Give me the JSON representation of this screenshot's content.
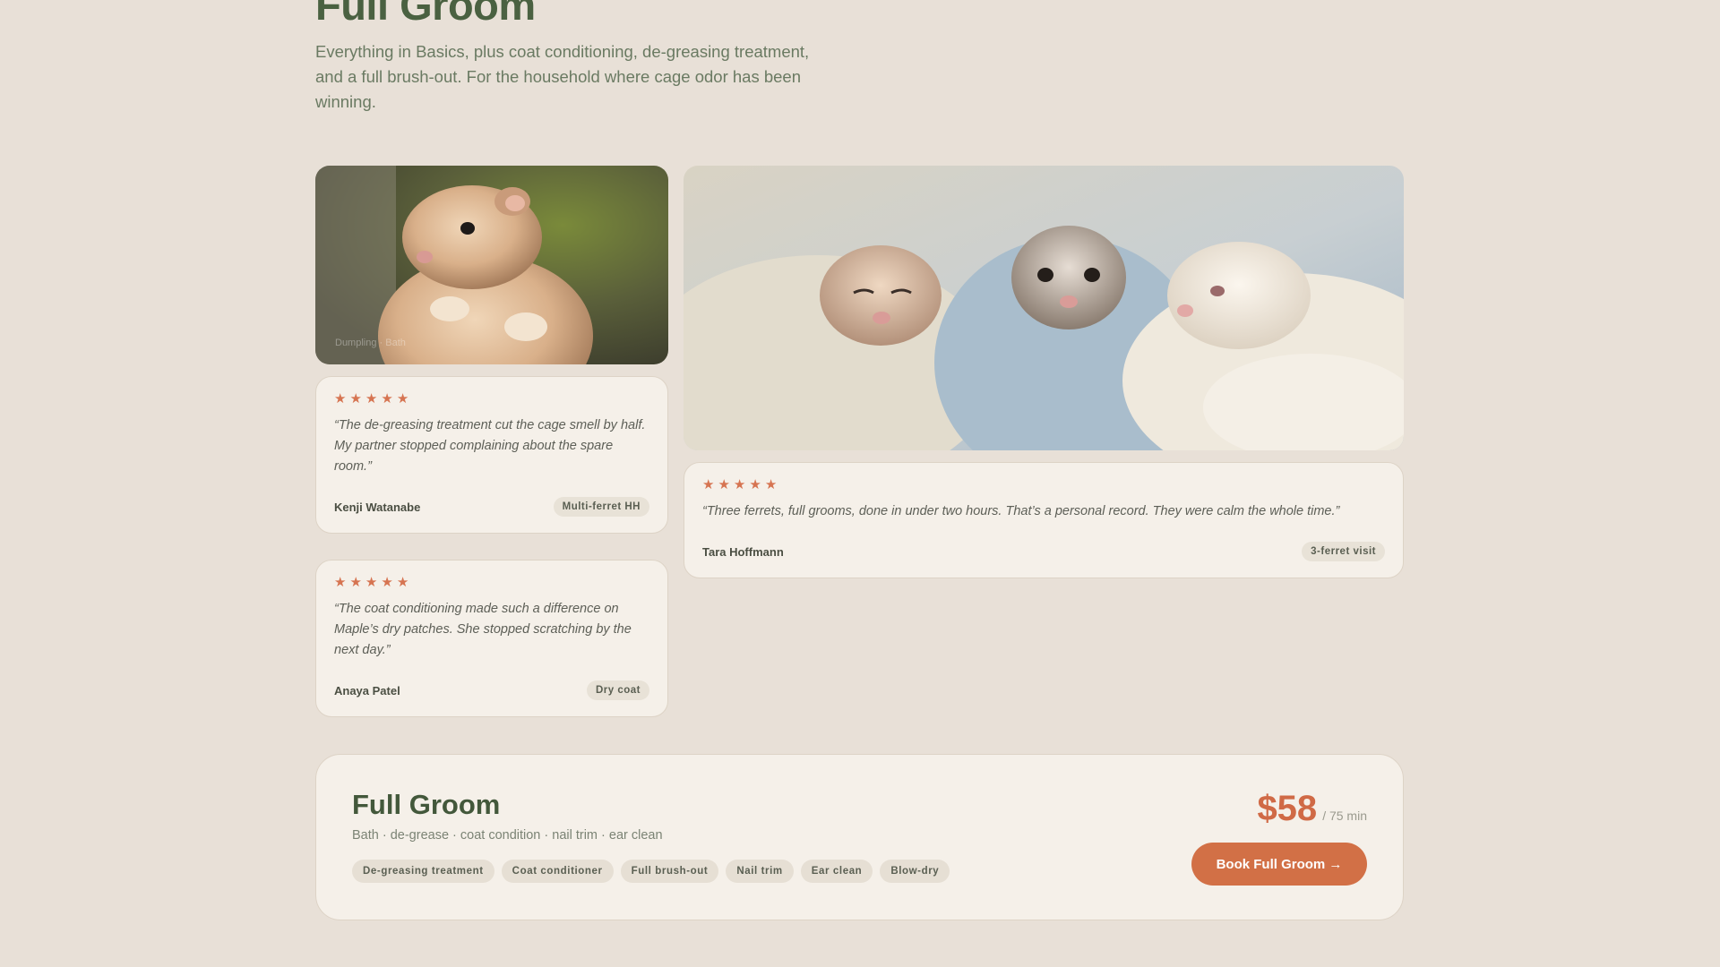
{
  "header": {
    "title": "Full Groom",
    "intro": "Everything in Basics, plus coat conditioning, de-greasing treatment, and a full brush-out. For the household where cage odor has been winning."
  },
  "photos": {
    "single": {
      "caption": "Dumpling · Bath",
      "subject": "ferret-photo"
    },
    "trio": {
      "caption": "",
      "subject": "three-ferrets-in-blankets-photo"
    }
  },
  "testimonials": [
    {
      "rating": 5,
      "quote": "“The de-greasing treatment cut the cage smell by half. My partner stopped complaining about the spare room.”",
      "author": "Kenji Watanabe",
      "tag": "Multi-ferret HH"
    },
    {
      "rating": 5,
      "quote": "“The coat conditioning made such a difference on Maple’s dry patches. She stopped scratching by the next day.”",
      "author": "Anaya Patel",
      "tag": "Dry coat"
    },
    {
      "rating": 5,
      "quote": "“Three ferrets, full grooms, done in under two hours. That’s a personal record. They were calm the whole time.”",
      "author": "Tara Hoffmann",
      "tag": "3-ferret visit"
    }
  ],
  "package": {
    "title": "Full Groom",
    "subtitle": "Bath · de-grease · coat condition · nail trim · ear clean",
    "features": [
      "De-greasing treatment",
      "Coat conditioner",
      "Full brush-out",
      "Nail trim",
      "Ear clean",
      "Blow-dry"
    ],
    "price": "$58",
    "duration": "/ 75 min",
    "cta": "Book Full Groom →"
  },
  "colors": {
    "background": "#e8e0d7",
    "card": "#f5f0e9",
    "accent": "#d27046",
    "heading": "#4a6141",
    "star": "#d67451"
  }
}
